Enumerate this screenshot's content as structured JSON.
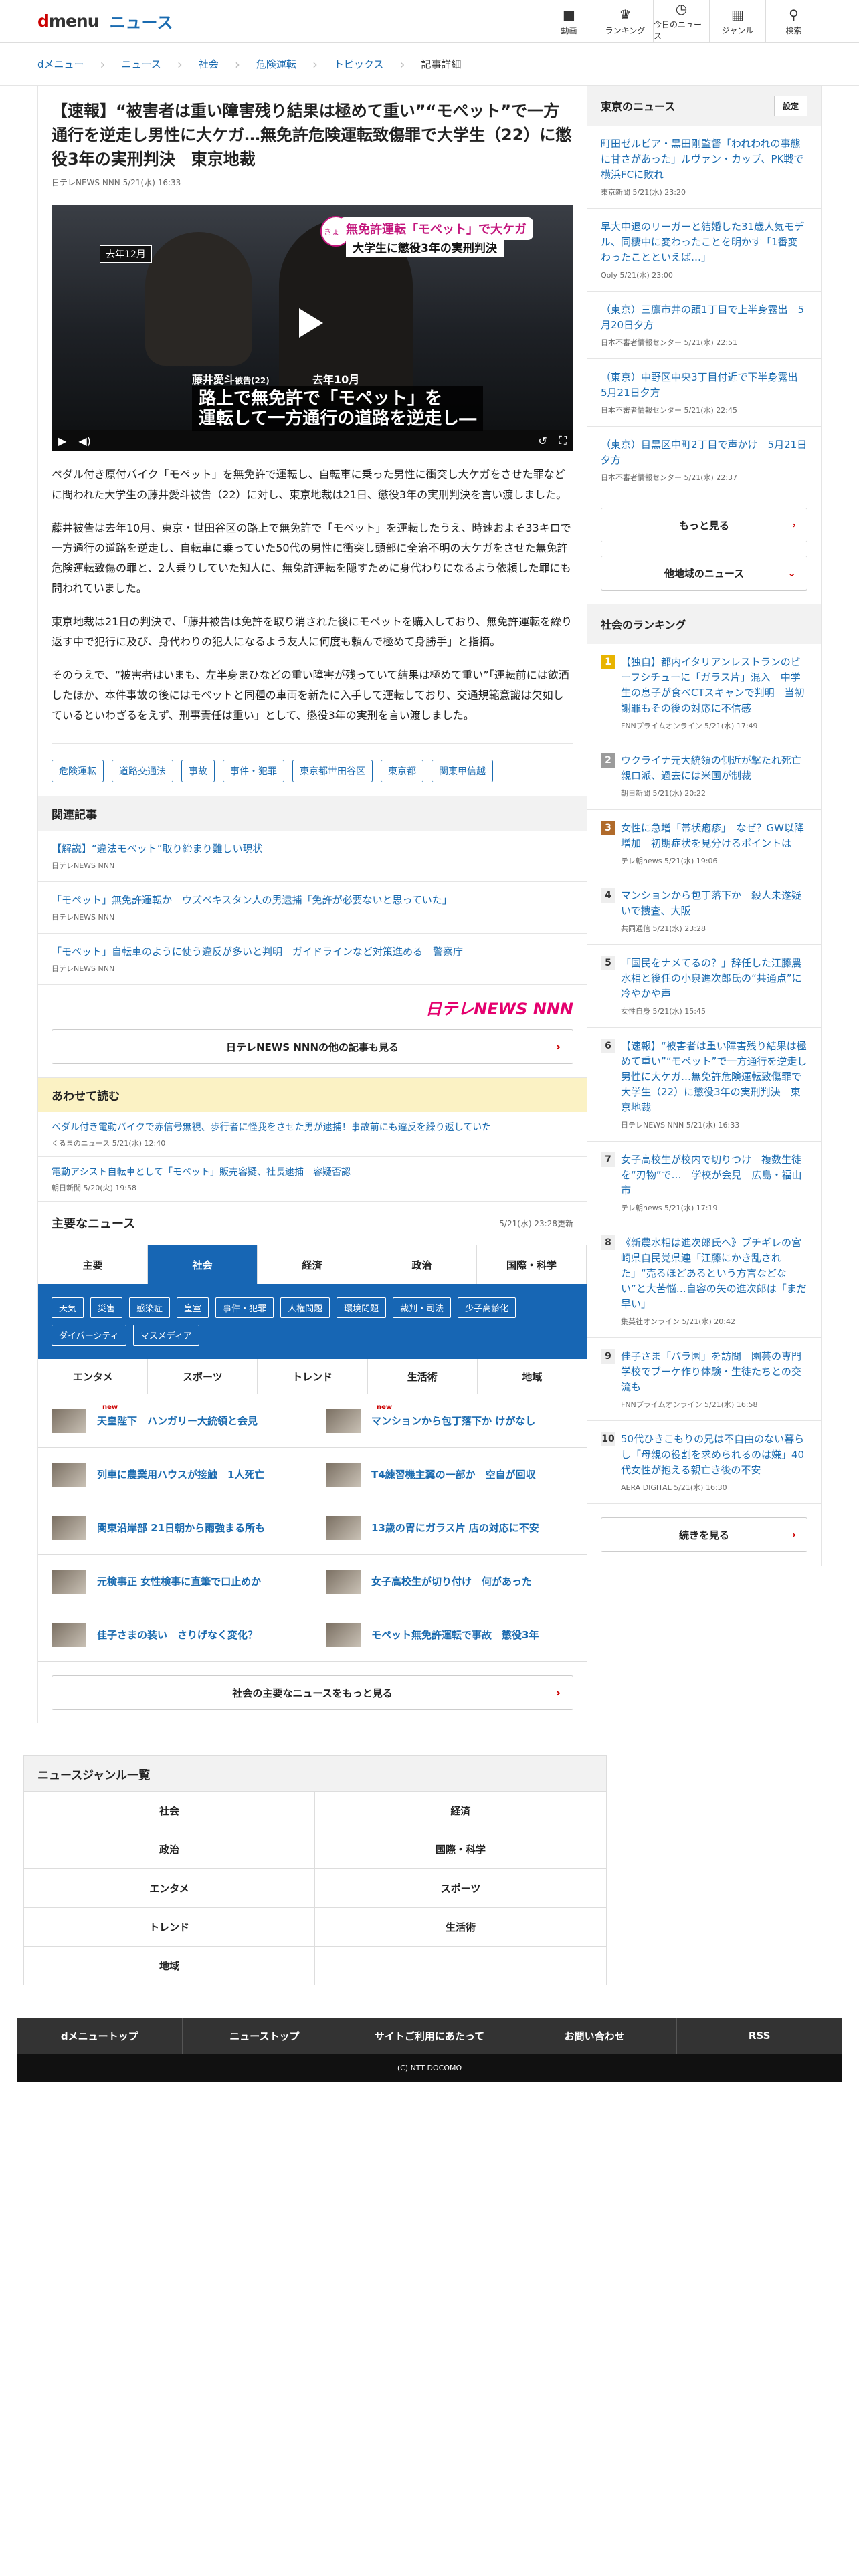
{
  "header": {
    "logo_d": "d",
    "logo_menu": "menu",
    "news_label": "ニュース",
    "nav": [
      {
        "icon": "■",
        "label": "動画"
      },
      {
        "icon": "♛",
        "label": "ランキング"
      },
      {
        "icon": "◷",
        "label": "今日のニュース"
      },
      {
        "icon": "▦",
        "label": "ジャンル"
      },
      {
        "icon": "⚲",
        "label": "検索"
      }
    ]
  },
  "breadcrumb": [
    "dメニュー",
    "ニュース",
    "社会",
    "危険運転",
    "トピックス",
    "記事詳細"
  ],
  "article": {
    "title": "【速報】“被害者は重い障害残り結果は極めて重い”“モペット”で一方通行を逆走し男性に大ケガ…無免許危険運転致傷罪で大学生（22）に懲役3年の実刑判決　東京地裁",
    "source": "日テレNEWS NNN  5/21(水) 16:33",
    "video": {
      "kyo": "きょう",
      "cap1": "無免許運転「モペット」で大ケガ",
      "cap2": "大学生に懲役3年の実刑判決",
      "tag": "去年12月",
      "name": "藤井愛斗",
      "name_suffix": "被告(22)",
      "date2": "去年10月",
      "sub1": "路上で無免許で「モペット」を",
      "sub2": "運転して一方通行の道路を逆走し―"
    },
    "paras": [
      "ペダル付き原付バイク「モペット」を無免許で運転し、自転車に乗った男性に衝突し大ケガをさせた罪などに問われた大学生の藤井愛斗被告（22）に対し、東京地裁は21日、懲役3年の実刑判決を言い渡しました。",
      "藤井被告は去年10月、東京・世田谷区の路上で無免許で「モペット」を運転したうえ、時速およそ33キロで一方通行の道路を逆走し、自転車に乗っていた50代の男性に衝突し頭部に全治不明の大ケガをさせた無免許危険運転致傷の罪と、2人乗りしていた知人に、無免許運転を隠すために身代わりになるよう依頼した罪にも問われていました。",
      "東京地裁は21日の判決で、「藤井被告は免許を取り消された後にモペットを購入しており、無免許運転を繰り返す中で犯行に及び、身代わりの犯人になるよう友人に何度も頼んで極めて身勝手」と指摘。",
      "そのうえで、“被害者はいまも、左半身まひなどの重い障害が残っていて結果は極めて重い”「運転前には飲酒したほか、本件事故の後にはモペットと同種の車両を新たに入手して運転しており、交通規範意識は欠如しているといわざるをえず、刑事責任は重い」として、懲役3年の実刑を言い渡しました。"
    ],
    "tags": [
      "危険運転",
      "道路交通法",
      "事故",
      "事件・犯罪",
      "東京都世田谷区",
      "東京都",
      "関東甲信越"
    ]
  },
  "related": {
    "heading": "関連記事",
    "items": [
      {
        "t": "【解説】“違法モペット”取り締まり難しい現状",
        "s": "日テレNEWS NNN"
      },
      {
        "t": "「モペット」無免許運転か　ウズベキスタン人の男逮捕「免許が必要ないと思っていた」",
        "s": "日テレNEWS NNN"
      },
      {
        "t": "「モペット」自転車のように使う違反が多いと判明　ガイドラインなど対策進める　警察庁",
        "s": "日テレNEWS NNN"
      }
    ],
    "ntv_logo": "日テレNEWS NNN",
    "more": "日テレNEWS NNNの他の記事も見る"
  },
  "awase": {
    "heading": "あわせて読む",
    "items": [
      {
        "t": "ペダル付き電動バイクで赤信号無視、歩行者に怪我をさせた男が逮捕！事故前にも違反を繰り返していた",
        "s": "くるまのニュース  5/21(水) 12:40"
      },
      {
        "t": "電動アシスト自転車として「モペット」販売容疑、社長逮捕　容疑否認",
        "s": "朝日新聞  5/20(火) 19:58"
      }
    ]
  },
  "topnews": {
    "heading": "主要なニュース",
    "updated": "5/21(水) 23:28更新",
    "tabs": [
      "主要",
      "社会",
      "経済",
      "政治",
      "国際・科学"
    ],
    "subcats": [
      "天気",
      "災害",
      "感染症",
      "皇室",
      "事件・犯罪",
      "人権問題",
      "環境問題",
      "裁判・司法",
      "少子高齢化",
      "ダイバーシティ",
      "マスメディア"
    ],
    "gtabs": [
      "エンタメ",
      "スポーツ",
      "トレンド",
      "生活術",
      "地域"
    ],
    "new_label": "new",
    "items": [
      {
        "t": "天皇陛下　ハンガリー大統領と会見",
        "new": true
      },
      {
        "t": "マンションから包丁落下か けがなし",
        "new": true
      },
      {
        "t": "列車に農業用ハウスが接触　1人死亡",
        "new": false
      },
      {
        "t": "T4練習機主翼の一部か　空自が回収",
        "new": false
      },
      {
        "t": "関東沿岸部 21日朝から雨強まる所も",
        "new": false
      },
      {
        "t": "13歳の胃にガラス片 店の対応に不安",
        "new": false
      },
      {
        "t": "元検事正 女性検事に直筆で口止めか",
        "new": false
      },
      {
        "t": "女子高校生が切り付け　何があった",
        "new": false
      },
      {
        "t": "佳子さまの装い　さりげなく変化？",
        "new": false
      },
      {
        "t": "モペット無免許運転で事故　懲役3年",
        "new": false
      }
    ],
    "more": "社会の主要なニュースをもっと見る"
  },
  "genres": {
    "heading": "ニュースジャンル一覧",
    "items": [
      "社会",
      "経済",
      "政治",
      "国際・科学",
      "エンタメ",
      "スポーツ",
      "トレンド",
      "生活術",
      "地域"
    ]
  },
  "footer": {
    "nav": [
      "dメニュートップ",
      "ニューストップ",
      "サイトご利用にあたって",
      "お問い合わせ",
      "RSS"
    ],
    "copyright": "(C) NTT DOCOMO"
  },
  "sidebar": {
    "local_heading": "東京のニュース",
    "settings": "設定",
    "local_items": [
      {
        "t": "町田ゼルビア・黒田剛監督「われわれの事態に甘さがあった」ルヴァン・カップ、PK戦で横浜FCに敗れ",
        "s": "東京新聞  5/21(水) 23:20"
      },
      {
        "t": "早大中退のリーガーと結婚した31歳人気モデル、同棲中に変わったことを明かす「1番変わったことといえば…」",
        "s": "Qoly  5/21(水) 23:00"
      },
      {
        "t": "（東京）三鷹市井の頭1丁目で上半身露出　5月20日夕方",
        "s": "日本不審者情報センター  5/21(水) 22:51"
      },
      {
        "t": "（東京）中野区中央3丁目付近で下半身露出　5月21日夕方",
        "s": "日本不審者情報センター  5/21(水) 22:45"
      },
      {
        "t": "（東京）目黒区中町2丁目で声かけ　5月21日夕方",
        "s": "日本不審者情報センター  5/21(水) 22:37"
      }
    ],
    "more": "もっと見る",
    "other_area": "他地域のニュース",
    "rank_heading": "社会のランキング",
    "ranks": [
      {
        "n": "1",
        "t": "【独自】都内イタリアンレストランのビーフシチューに「ガラス片」混入　中学生の息子が食べCTスキャンで判明　当初謝罪もその後の対応に不信感",
        "s": "FNNプライムオンライン  5/21(水) 17:49"
      },
      {
        "n": "2",
        "t": "ウクライナ元大統領の側近が撃たれ死亡　親ロ派、過去には米国が制裁",
        "s": "朝日新聞  5/21(水) 20:22"
      },
      {
        "n": "3",
        "t": "女性に急増「帯状疱疹」　なぜ？GW以降増加　初期症状を見分けるポイントは",
        "s": "テレ朝news  5/21(水) 19:06"
      },
      {
        "n": "4",
        "t": "マンションから包丁落下か　殺人未遂疑いで捜査、大阪",
        "s": "共同通信  5/21(水) 23:28"
      },
      {
        "n": "5",
        "t": "「国民をナメてるの？」辞任した江藤農水相と後任の小泉進次郎氏の“共通点”に冷やかや声",
        "s": "女性自身  5/21(水) 15:45"
      },
      {
        "n": "6",
        "t": "【速報】“被害者は重い障害残り結果は極めて重い”“モペット”で一方通行を逆走し男性に大ケガ…無免許危険運転致傷罪で大学生（22）に懲役3年の実刑判決　東京地裁",
        "s": "日テレNEWS NNN  5/21(水) 16:33"
      },
      {
        "n": "7",
        "t": "女子高校生が校内で切りつけ　複数生徒を“刃物”で…　学校が会見　広島・福山市",
        "s": "テレ朝news  5/21(水) 17:19"
      },
      {
        "n": "8",
        "t": "《新農水相は進次郎氏へ》ブチギレの宮崎県自民党県連「江藤にかき乱された」“売るほどあるという方言などない”と大苦悩…自容の矢の進次郎は「まだ早い」",
        "s": "集英社オンライン  5/21(水) 20:42"
      },
      {
        "n": "9",
        "t": "佳子さま「バラ園」を訪問　園芸の専門学校でブーケ作り体験・生徒たちとの交流も",
        "s": "FNNプライムオンライン  5/21(水) 16:58"
      },
      {
        "n": "10",
        "t": "50代ひきこもりの兄は不自由のない暮らし「母親の役割を求められるのは嫌」40代女性が抱える親亡き後の不安",
        "s": "AERA DIGITAL  5/21(水) 16:30"
      }
    ],
    "rank_more": "続きを見る"
  }
}
